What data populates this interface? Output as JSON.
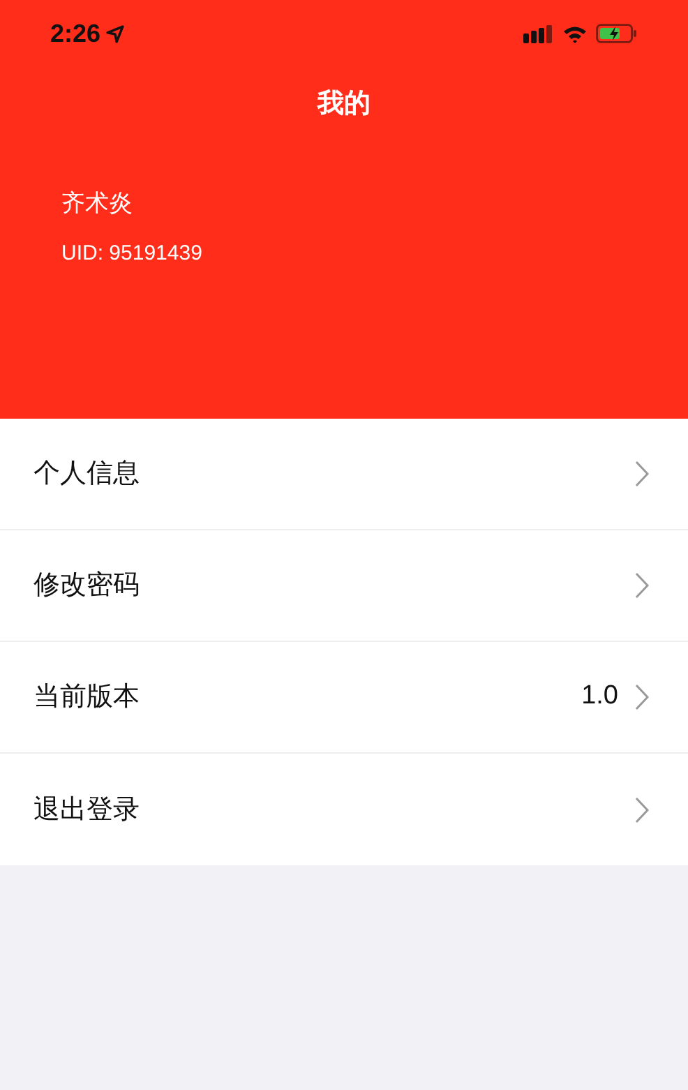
{
  "status_bar": {
    "time": "2:26"
  },
  "header": {
    "title": "我的",
    "name": "齐术炎",
    "uid": "UID: 95191439"
  },
  "menu": [
    {
      "label": "个人信息"
    },
    {
      "label": "修改密码"
    },
    {
      "label": "当前版本",
      "value": "1.0"
    },
    {
      "label": "退出登录"
    }
  ]
}
